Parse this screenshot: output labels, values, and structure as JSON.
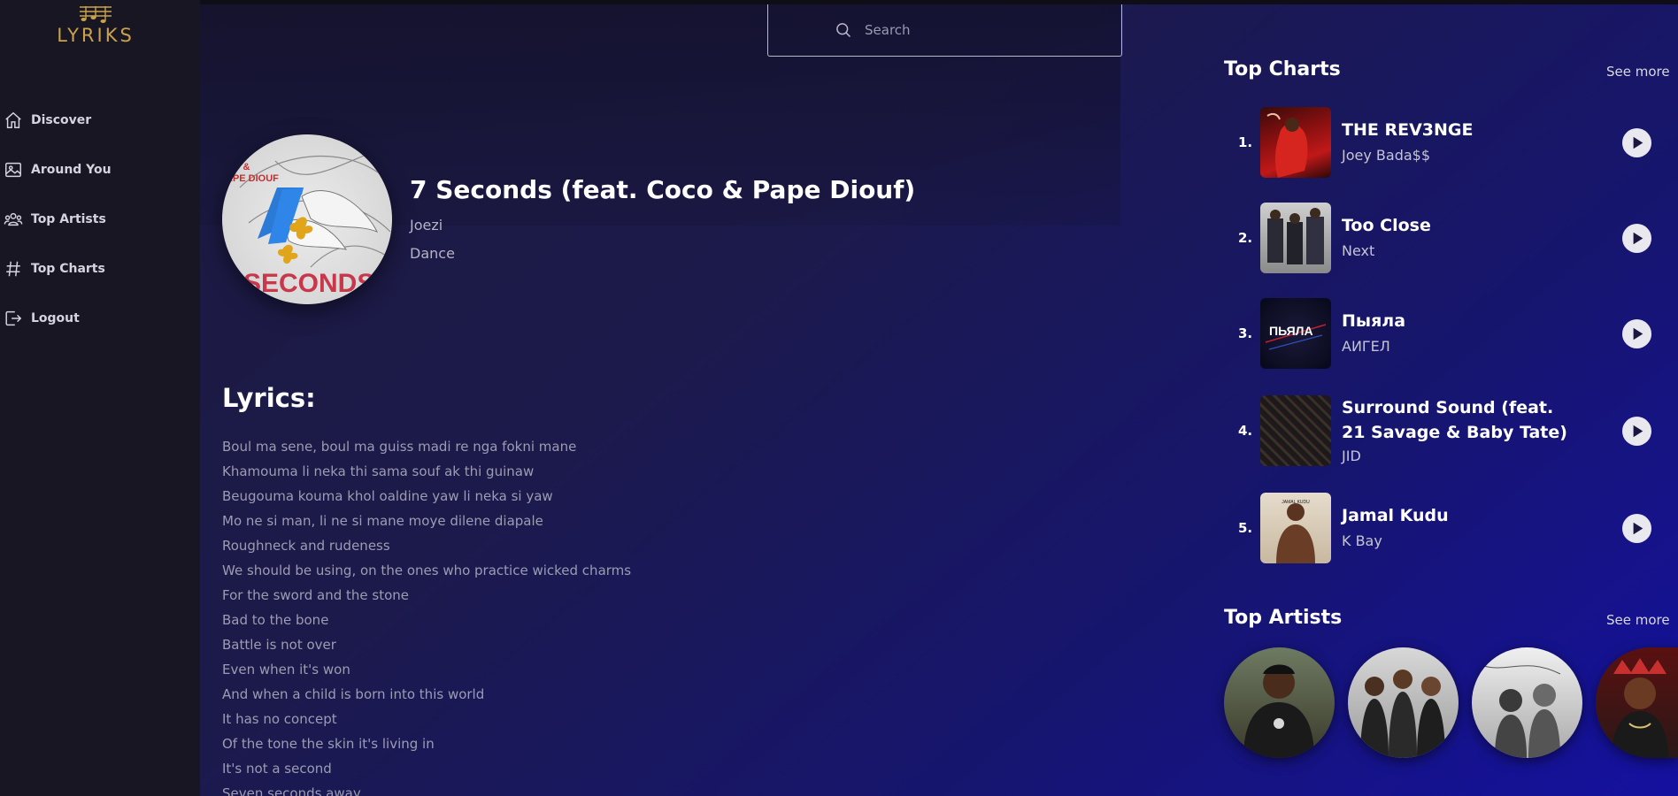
{
  "app": {
    "logo_text": "LYRIKS"
  },
  "sidebar": {
    "items": [
      {
        "label": "Discover",
        "icon": "home-icon"
      },
      {
        "label": "Around You",
        "icon": "image-icon"
      },
      {
        "label": "Top Artists",
        "icon": "users-icon"
      },
      {
        "label": "Top Charts",
        "icon": "hashtag-icon"
      },
      {
        "label": "Logout",
        "icon": "logout-icon"
      }
    ]
  },
  "search": {
    "placeholder": "Search"
  },
  "song": {
    "title": "7 Seconds (feat. Coco & Pape Diouf)",
    "artist": "Joezi",
    "genre": "Dance",
    "cover_text_top": "CO &",
    "cover_text_top2": "APE DIOUF",
    "cover_text_bottom": "SECONDS",
    "cover_number": "7"
  },
  "lyrics": {
    "title": "Lyrics:",
    "lines": [
      "Boul ma sene, boul ma guiss madi re nga fokni mane",
      "Khamouma li neka thi sama souf ak thi guinaw",
      "Beugouma kouma khol oaldine yaw li neka si yaw",
      "Mo ne si man, li ne si mane moye dilene diapale",
      "Roughneck and rudeness",
      "We should be using, on the ones who practice wicked charms",
      "For the sword and the stone",
      "Bad to the bone",
      "Battle is not over",
      "Even when it's won",
      "And when a child is born into this world",
      "It has no concept",
      "Of the tone the skin it's living in",
      "It's not a second",
      "Seven seconds away"
    ]
  },
  "top_charts": {
    "title": "Top Charts",
    "see_more": "See more",
    "tracks": [
      {
        "rank": "1.",
        "title": "THE REV3NGE",
        "artist": "Joey Bada$$"
      },
      {
        "rank": "2.",
        "title": "Too Close",
        "artist": "Next"
      },
      {
        "rank": "3.",
        "title": "Пыяла",
        "artist": "АИГЕЛ",
        "cover_text": "ПЬЯЛА"
      },
      {
        "rank": "4.",
        "title": "Surround Sound (feat. 21 Savage & Baby Tate)",
        "artist": "JID"
      },
      {
        "rank": "5.",
        "title": "Jamal Kudu",
        "artist": "K Bay",
        "cover_text": "JAMAL KUDU"
      }
    ]
  },
  "top_artists": {
    "title": "Top Artists",
    "see_more": "See more"
  },
  "colors": {
    "sidebar_bg": "#191624",
    "accent_gold": "#c9a24a",
    "gradient_end": "#1511a0"
  }
}
